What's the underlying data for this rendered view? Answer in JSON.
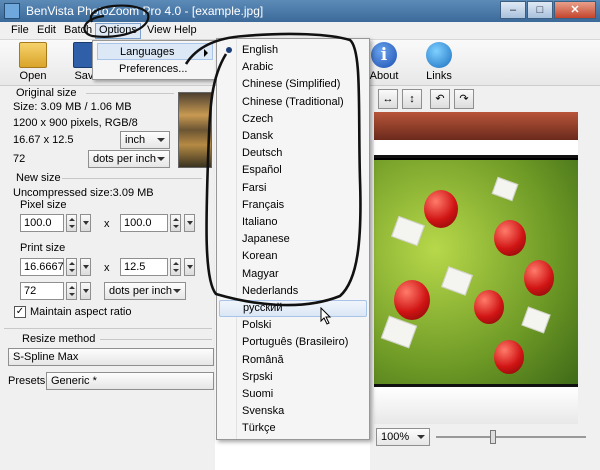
{
  "window": {
    "title": "BenVista PhotoZoom Pro 4.0 - [example.jpg]"
  },
  "menubar": {
    "items": [
      "File",
      "Edit",
      "Batch",
      "Options",
      "View",
      "Help"
    ]
  },
  "toolbar": {
    "open_label": "Open",
    "save_label": "Save",
    "about_label": "About",
    "links_label": "Links"
  },
  "options_menu": {
    "items": [
      "Languages",
      "Preferences..."
    ]
  },
  "languages": {
    "selected": "English",
    "highlighted": "русский",
    "items": [
      "English",
      "Arabic",
      "Chinese (Simplified)",
      "Chinese (Traditional)",
      "Czech",
      "Dansk",
      "Deutsch",
      "Español",
      "Farsi",
      "Français",
      "Italiano",
      "Japanese",
      "Korean",
      "Magyar",
      "Nederlands",
      "русский",
      "Polski",
      "Português (Brasileiro)",
      "Română",
      "Srpski",
      "Suomi",
      "Svenska",
      "Türkçe"
    ]
  },
  "original_size": {
    "heading": "Original size",
    "size_line": "Size: 3.09 MB / 1.06 MB",
    "pixels_line": "1200 x 900 pixels, RGB/8",
    "dims": "16.67 x 12.5",
    "unit": "inch",
    "resolution": "72",
    "resolution_unit": "dots per inch"
  },
  "new_size": {
    "heading": "New size",
    "uncompressed": "Uncompressed size:3.09 MB",
    "pixel_size_label": "Pixel size",
    "pixel_w": "100.0",
    "pixel_h": "100.0",
    "times": "x",
    "print_size_label": "Print size",
    "print_w": "16.6667",
    "print_h": "12.5",
    "print_res": "72",
    "print_res_unit": "dots per inch",
    "maintain_aspect": "Maintain aspect ratio"
  },
  "resize": {
    "heading": "Resize method",
    "method": "S-Spline Max",
    "presets_label": "Presets:",
    "preset": "Generic *"
  },
  "zoom": {
    "value": "100%"
  },
  "colors": {
    "menu_highlight": "#dbe7f6",
    "title_bar": "#3b6a9a"
  }
}
